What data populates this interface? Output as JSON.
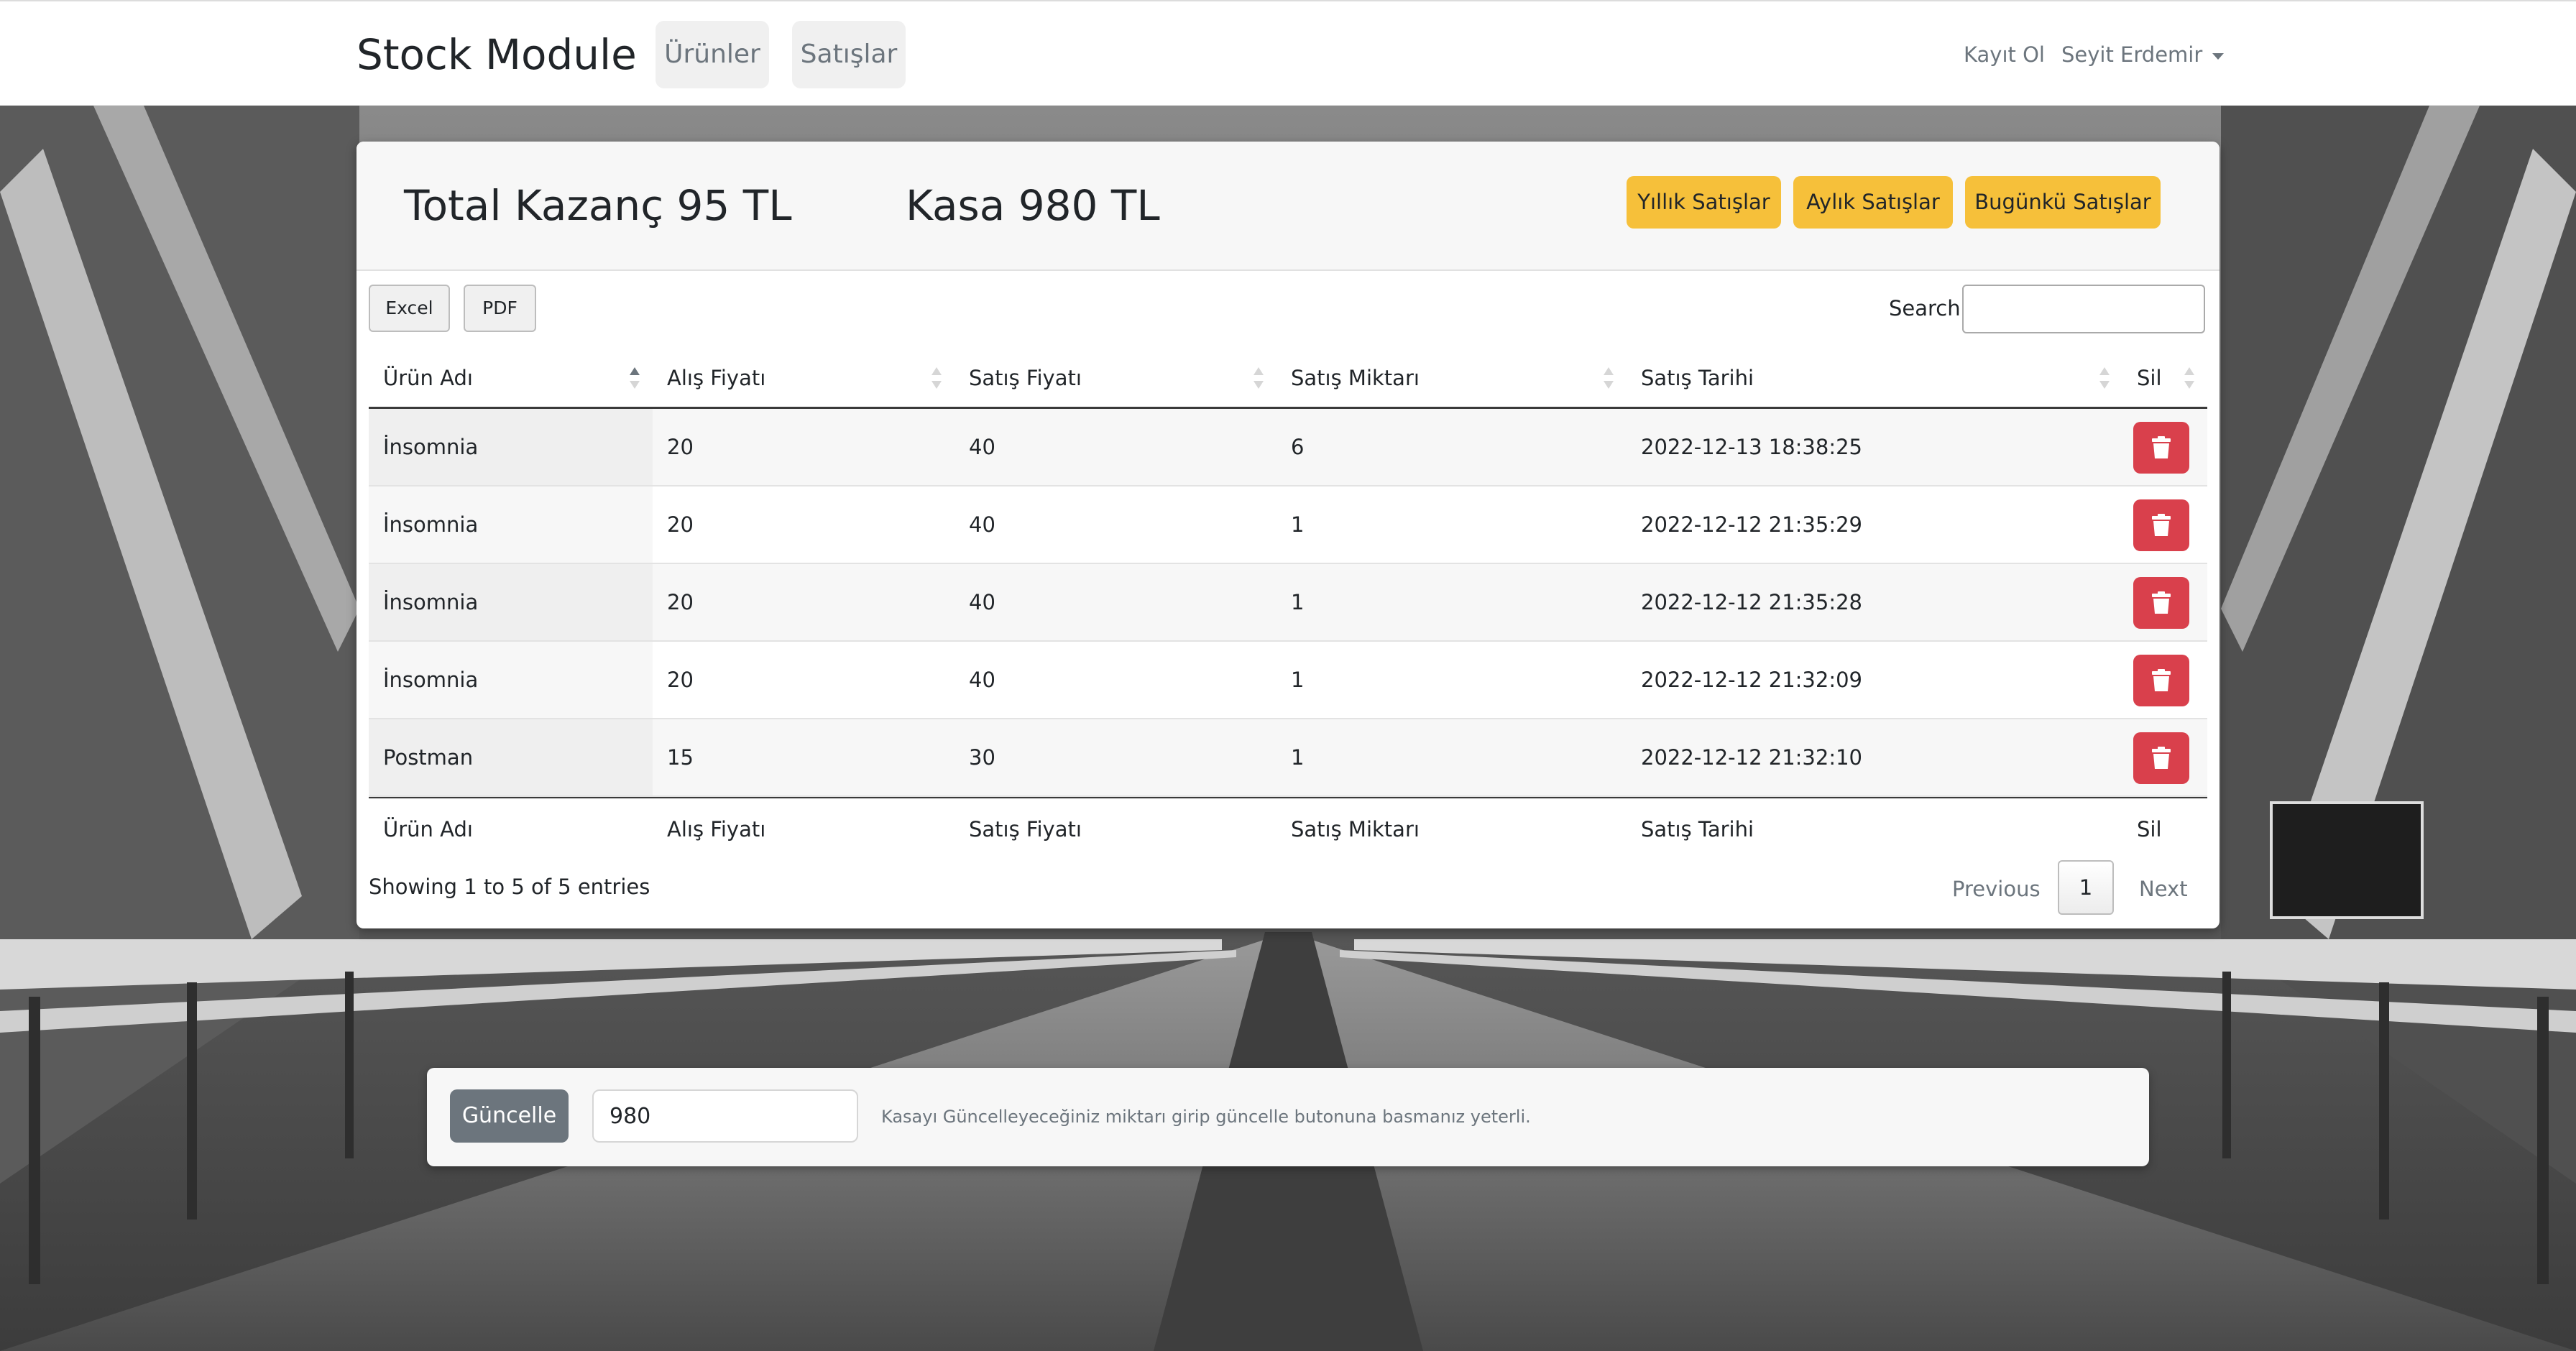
{
  "navbar": {
    "brand": "Stock Module",
    "links": [
      "Ürünler",
      "Satışlar"
    ],
    "register": "Kayıt Ol",
    "user": "Seyit Erdemir"
  },
  "summary": {
    "total_profit": "Total Kazanç 95 TL",
    "cash": "Kasa 980 TL",
    "buttons": [
      "Yıllık Satışlar",
      "Aylık Satışlar",
      "Bugünkü Satışlar"
    ]
  },
  "datatable": {
    "export_buttons": [
      "Excel",
      "PDF"
    ],
    "search_label": "Search:",
    "search_value": "",
    "columns": [
      "Ürün Adı",
      "Alış Fiyatı",
      "Satış Fiyatı",
      "Satış Miktarı",
      "Satış Tarihi",
      "Sil"
    ],
    "rows": [
      [
        "İnsomnia",
        "20",
        "40",
        "6",
        "2022-12-13 18:38:25"
      ],
      [
        "İnsomnia",
        "20",
        "40",
        "1",
        "2022-12-12 21:35:29"
      ],
      [
        "İnsomnia",
        "20",
        "40",
        "1",
        "2022-12-12 21:35:28"
      ],
      [
        "İnsomnia",
        "20",
        "40",
        "1",
        "2022-12-12 21:32:09"
      ],
      [
        "Postman",
        "15",
        "30",
        "1",
        "2022-12-12 21:32:10"
      ]
    ],
    "sorted_column": "Ürün Adı",
    "info": "Showing 1 to 5 of 5 entries",
    "pagination": {
      "previous": "Previous",
      "current": "1",
      "next": "Next"
    }
  },
  "update_bar": {
    "button": "Güncelle",
    "value": "980",
    "help": "Kasayı Güncelleyeceğiniz miktarı girip güncelle butonuna basmanız yeterli."
  },
  "colors": {
    "warning": "#f6c03a",
    "danger": "#d9404c",
    "secondary": "#6c757d"
  },
  "icons": {
    "delete": "trash-icon",
    "dropdown": "caret-down-icon",
    "sort": "sort-icon"
  }
}
